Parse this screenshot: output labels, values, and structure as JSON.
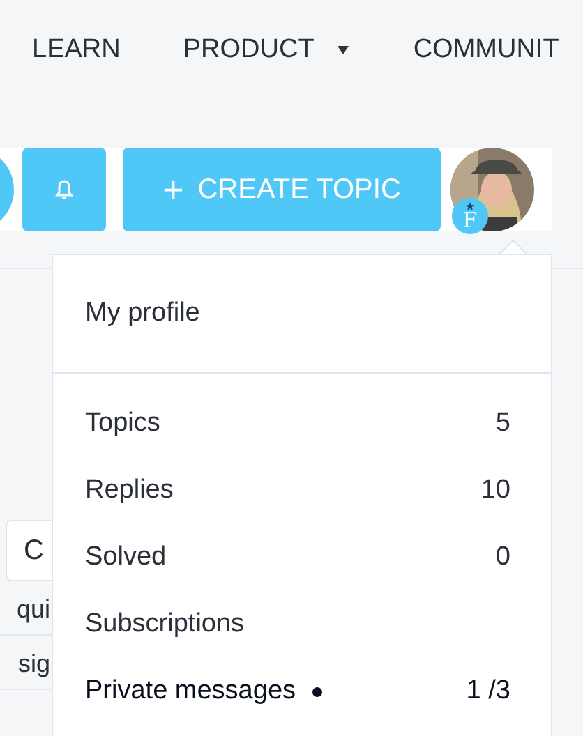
{
  "nav": [
    {
      "label": "LEARN",
      "dropdown": false
    },
    {
      "label": "PRODUCT",
      "dropdown": true
    },
    {
      "label": "COMMUNIT",
      "dropdown": false
    }
  ],
  "toolbar": {
    "create_button": {
      "icon": "+",
      "label": "CREATE TOPIC"
    },
    "avatar_badge": "F"
  },
  "background": {
    "field_value": "C",
    "rows": [
      "qui",
      "sig"
    ]
  },
  "menu": {
    "header_item": "My profile",
    "items": [
      {
        "label": "Topics",
        "count": "5",
        "unread": false
      },
      {
        "label": "Replies",
        "count": "10",
        "unread": false
      },
      {
        "label": "Solved",
        "count": "0",
        "unread": false
      },
      {
        "label": "Subscriptions",
        "unread": false
      },
      {
        "label": "Private messages",
        "count": "1 /3",
        "unread": true
      }
    ]
  }
}
